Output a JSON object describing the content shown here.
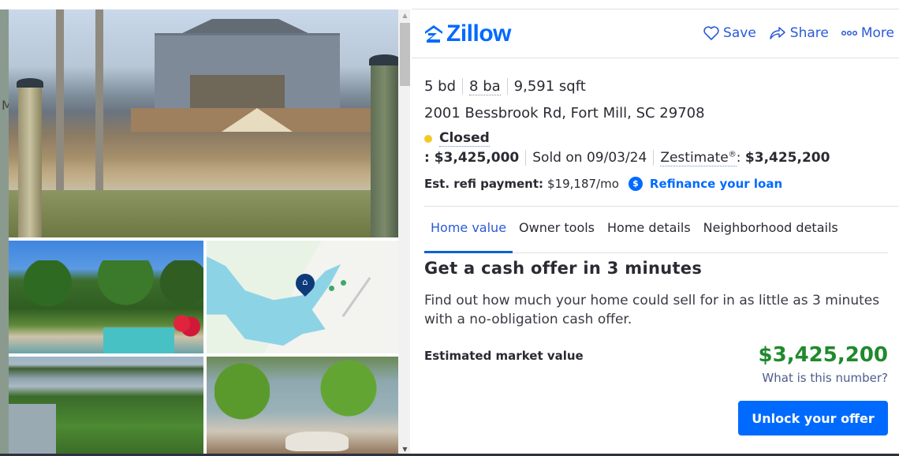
{
  "brand": {
    "name": "Zillow",
    "color": "#006aff"
  },
  "header": {
    "actions": [
      {
        "label": "Save",
        "icon": "heart-icon"
      },
      {
        "label": "Share",
        "icon": "share-arrow-icon"
      },
      {
        "label": "More",
        "icon": "more-dots-icon"
      }
    ]
  },
  "gallery": {
    "edge_text": "M",
    "photos": [
      {
        "alt": "Lakefront house exterior with dock posts"
      },
      {
        "alt": "Backyard pool and garden"
      },
      {
        "alt": "Map with home location pin"
      },
      {
        "alt": "Aerial lake view"
      },
      {
        "alt": "Lakefront yard with patio"
      }
    ],
    "scroll": {
      "up": "▲",
      "down": "▼"
    }
  },
  "listing": {
    "beds": "5 bd",
    "baths": "8 ba",
    "sqft": "9,591 sqft",
    "address": "2001 Bessbrook Rd, Fort Mill, SC 29708",
    "status": "Closed",
    "status_color": "#f2c925",
    "sold_price": ": $3,425,000",
    "sold_date": "Sold on 09/03/24",
    "zestimate_label": "Zestimate",
    "zestimate_reg": "®",
    "zestimate_sep": ": ",
    "zestimate_value": "$3,425,200",
    "refi_label": "Est. refi payment:",
    "refi_value": "$19,187/mo",
    "refi_icon": "$",
    "refi_link": "Refinance your loan"
  },
  "tabs": [
    {
      "label": "Home value",
      "active": true
    },
    {
      "label": "Owner tools",
      "active": false
    },
    {
      "label": "Home details",
      "active": false
    },
    {
      "label": "Neighborhood details",
      "active": false
    }
  ],
  "cash_offer": {
    "title": "Get a cash offer in 3 minutes",
    "description": "Find out how much your home could sell for in as little as 3 minutes with a no-obligation cash offer.",
    "emv_label": "Estimated market value",
    "emv_value": "$3,425,200",
    "emv_color": "#1f8a2d",
    "help_link": "What is this number?",
    "cta": "Unlock your offer"
  }
}
